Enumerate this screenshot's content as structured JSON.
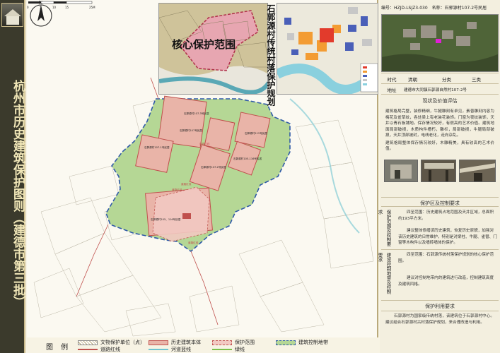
{
  "side_title": "杭州市历史建筑保护图则（建德市第三批）",
  "map": {
    "inset1_label": "核心保护范围",
    "inset2_title": "石郭源村传统村落保护规划",
    "compass_letter": "N",
    "scale_labels": [
      "0",
      "5",
      "10",
      "15",
      "25M"
    ],
    "building_labels": [
      "石郭源村107-3号民居",
      "石郭源村107-1号民居",
      "石郭源村107号民居",
      "石郭源村112号民居",
      "石郭源村107-2号民居",
      "石郭源村105-116号民居",
      "石郭源村95号民居",
      "石郭源村105、116号民居"
    ],
    "road_labels": [
      "道路红线",
      "道路红线",
      "道路红线",
      "道路红线"
    ]
  },
  "legend": {
    "title": "图 例",
    "items": [
      {
        "label": "文物保护单位（点）",
        "kind": "hatch"
      },
      {
        "label": "历史建筑本体",
        "kind": "fill"
      },
      {
        "label": "保护范围",
        "kind": "dash"
      },
      {
        "label": "建筑控制地带",
        "kind": "green"
      },
      {
        "label": "道路红线",
        "kind": "redline"
      },
      {
        "label": "河道蓝线",
        "kind": "blueline"
      },
      {
        "label": "绿线",
        "kind": "greenline"
      }
    ]
  },
  "info": {
    "code_label": "编号：",
    "code_value": "HZJD-LSJZ3-030",
    "name_label": "名称：",
    "name_value": "石郭源村107-2号民居",
    "era_label": "时代",
    "era_value": "清朝",
    "category_label": "分类",
    "category_value": "三类",
    "address_label": "地址",
    "address_value": "建德市大同镇石郭源自然村107-2号"
  },
  "status": {
    "header": "现状及价值评估",
    "para1": "建筑格局完整，装修精细，牛腿雕刻有卓见，素普雕刻内容为梅花及雀草纹，各处梁上有老装花装饰。门窗为夜纹装饰，天井以青石板铺地。保存情况较好，有很高的艺术价值。建筑地面局部破损，木质构件槽朽，雕栏，局部破损，牛腿局部破损，天井顶部被封，电线老化，走向杂乱。",
    "para2": "建筑格局整体保存情况较好，木雕精美，具有较高的艺术价值。"
  },
  "control": {
    "header": "保护区及控制要求",
    "label1": "保护范围及控制要求",
    "text1a": "四至范围：历史建筑占地范围及天井区域，总面积约193平方米。",
    "text1b": "建议整体修缮该历史建筑，恢复历史原貌，加强对该历史建筑的日常维护，特别是对梁柱、牛腿、雀替、门窗等木构件以及墙砖墙体的保护。",
    "label2": "建设控制地带及控制要求",
    "text2a": "四至范围：石郭源传统村落保护规划的核心保护范围。",
    "text2b": "建议对控制地带内的建筑进行改造，控制建筑高度及建筑风格。"
  },
  "usage": {
    "header": "保护利用要求",
    "text": "石郭源村为国家级传统村落，该建筑位于石郭源村中心。建议结合石郭源村古村落保护规划，来合理改造与利用。"
  },
  "colors": {
    "side_bg": "#3b3a2c",
    "side_text": "#f1e7b8",
    "control_green": "#b5d795",
    "heritage_pink": "#e9b4a8",
    "protect_pink": "#f2c9c2",
    "road_red": "#c0504d",
    "river_blue": "#6fc3d0"
  }
}
